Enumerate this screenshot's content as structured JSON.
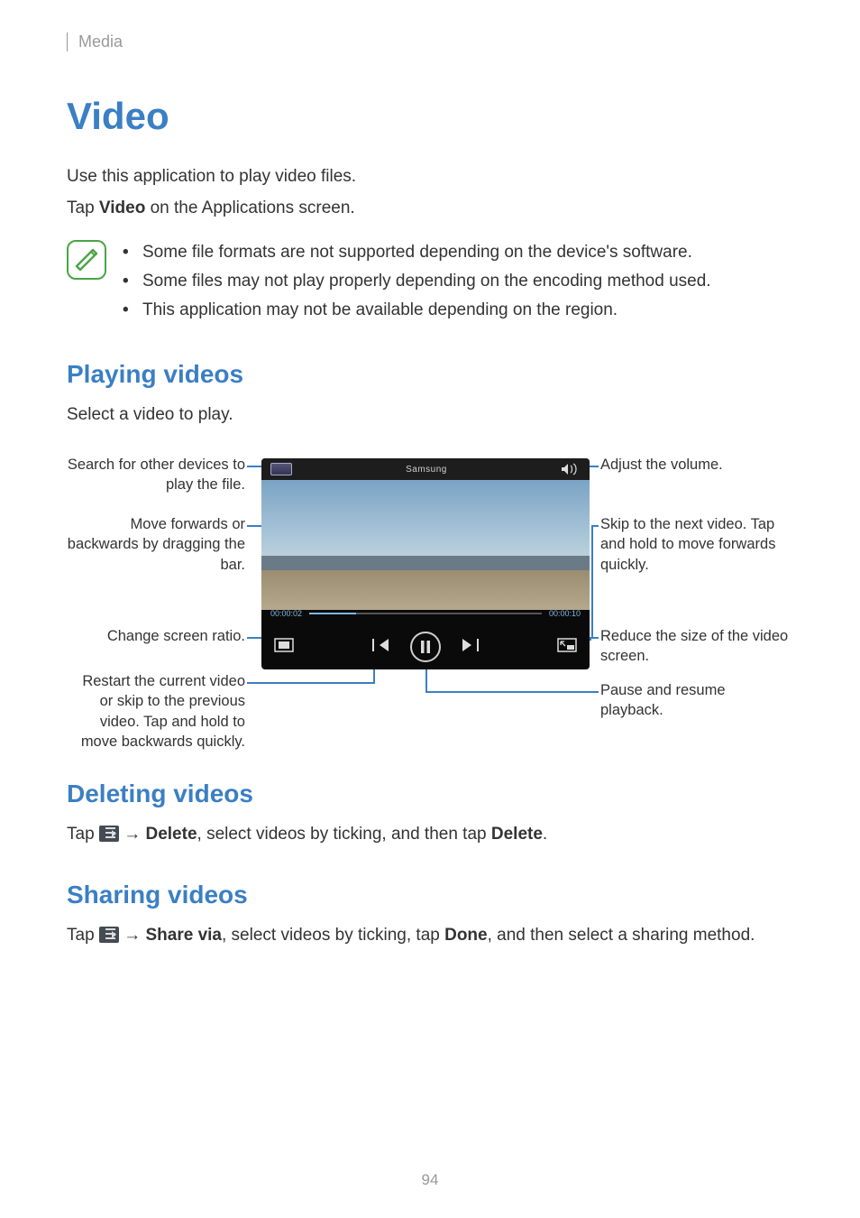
{
  "header": {
    "section": "Media"
  },
  "h1": "Video",
  "intro": {
    "line1": "Use this application to play video files.",
    "line2_pre": "Tap ",
    "line2_bold": "Video",
    "line2_post": " on the Applications screen."
  },
  "notes": [
    "Some file formats are not supported depending on the device's software.",
    "Some files may not play properly depending on the encoding method used.",
    "This application may not be available depending on the region."
  ],
  "playing": {
    "heading": "Playing videos",
    "subtitle": "Select a video to play.",
    "screenshot": {
      "title": "Samsung",
      "time_elapsed": "00:00:02",
      "time_total": "00:00:10"
    },
    "callouts": {
      "left": [
        "Search for other devices to play the file.",
        "Move forwards or backwards by dragging the bar.",
        "Change screen ratio.",
        "Restart the current video or skip to the previous video. Tap and hold to move backwards quickly."
      ],
      "right": [
        "Adjust the volume.",
        "Skip to the next video. Tap and hold to move forwards quickly.",
        "Reduce the size of the video screen.",
        "Pause and resume playback."
      ]
    }
  },
  "deleting": {
    "heading": "Deleting videos",
    "pre": "Tap ",
    "arrow": " → ",
    "bold1": "Delete",
    "mid": ", select videos by ticking, and then tap ",
    "bold2": "Delete",
    "post": "."
  },
  "sharing": {
    "heading": "Sharing videos",
    "pre": "Tap ",
    "arrow": " → ",
    "bold1": "Share via",
    "mid": ", select videos by ticking, tap ",
    "bold2": "Done",
    "post": ", and then select a sharing method."
  },
  "page_number": "94"
}
